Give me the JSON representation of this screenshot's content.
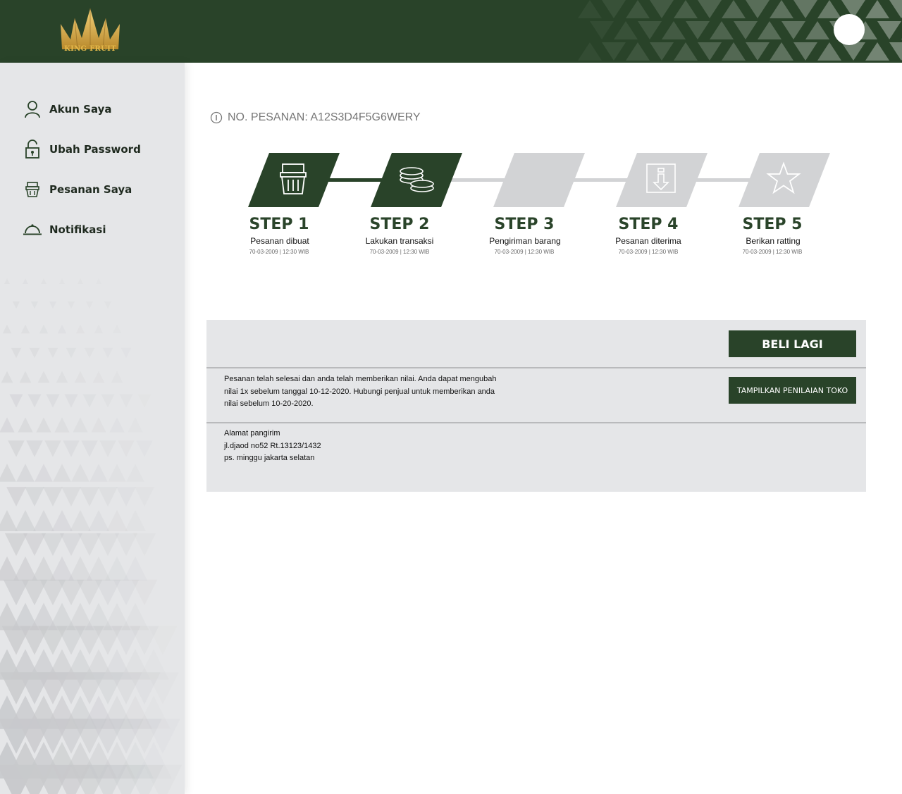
{
  "header": {
    "brand": "KING FRUIT",
    "bg_color": "#294329",
    "logo_color": "#e3b94b"
  },
  "sidebar": {
    "items": [
      {
        "label": "Akun Saya",
        "icon": "user-icon"
      },
      {
        "label": "Ubah Password",
        "icon": "lock-icon"
      },
      {
        "label": "Pesanan Saya",
        "icon": "basket-icon"
      },
      {
        "label": "Notifikasi",
        "icon": "bell-icon"
      }
    ]
  },
  "order": {
    "number_text": "NO. PESANAN: A12S3D4F5G6WERY"
  },
  "steps": [
    {
      "title": "STEP 1",
      "subtitle": "Pesanan dibuat",
      "date": "70-03-2009 | 12:30 WIB",
      "icon": "basket-icon",
      "active": true
    },
    {
      "title": "STEP 2",
      "subtitle": "Lakukan transaksi",
      "date": "70-03-2009 | 12:30 WIB",
      "icon": "coins-icon",
      "active": true
    },
    {
      "title": "STEP 3",
      "subtitle": "Pengiriman barang",
      "date": "70-03-2009 | 12:30 WIB",
      "icon": "",
      "active": false
    },
    {
      "title": "STEP 4",
      "subtitle": "Pesanan diterima",
      "date": "70-03-2009 | 12:30 WIB",
      "icon": "download-box-icon",
      "active": false
    },
    {
      "title": "STEP 5",
      "subtitle": "Berikan ratting",
      "date": "70-03-2009 | 12:30 WIB",
      "icon": "star-icon",
      "active": false
    }
  ],
  "panel": {
    "beli_lagi": "BELI LAGI",
    "tampilkan_toko": "TAMPILKAN PENILAIAN TOKO",
    "message_lines": [
      "Pesanan telah selesai dan anda telah memberikan nilai. Anda dapat mengubah",
      "nilai 1x sebelum tanggal 10-12-2020. Hubungi penjual untuk memberikan anda",
      "nilai sebelum 10-20-2020."
    ],
    "address_title": "Alamat pangirim",
    "address_line1": "jl.djaod no52 Rt.13123/1432",
    "address_line2": "ps. minggu jakarta selatan"
  },
  "colors": {
    "primary": "#294329",
    "inactive": "#d2d3d5",
    "panel_bg": "#e5e6e8"
  }
}
